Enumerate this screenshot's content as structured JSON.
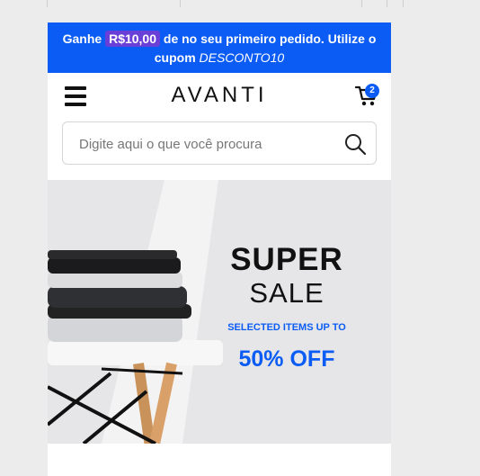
{
  "promo": {
    "prefix": "Ganhe",
    "amount": "R$10,00",
    "middle": "de no seu primeiro pedido. Utilize o cupom",
    "code": "DESCONTO10"
  },
  "header": {
    "logo": "AVANTI",
    "cart_count": "2"
  },
  "search": {
    "placeholder": "Digite aqui o que você procura"
  },
  "banner": {
    "line1": "SUPER",
    "line2": "SALE",
    "subtitle": "SELECTED ITEMS UP TO",
    "discount": "50% OFF"
  },
  "colors": {
    "brand_blue": "#0a5cf5",
    "badge_purple": "#6a3fd8",
    "banner_bg": "#e6e6e8"
  },
  "icons": [
    "menu-icon",
    "cart-icon",
    "search-icon"
  ]
}
